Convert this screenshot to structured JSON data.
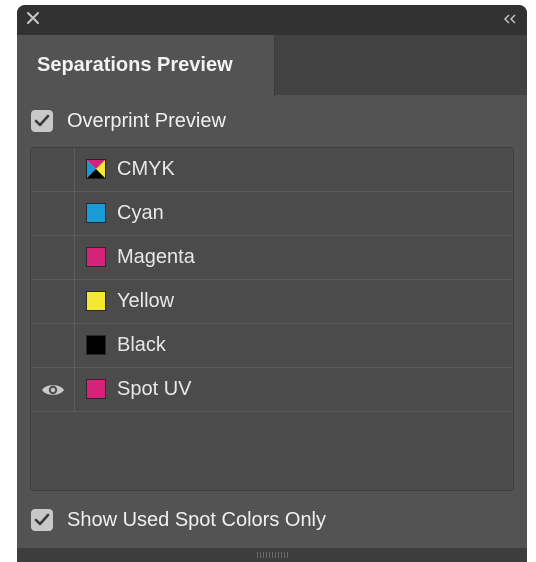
{
  "panel": {
    "tab_title": "Separations Preview"
  },
  "overprint": {
    "label": "Overprint Preview",
    "checked": true
  },
  "separations": [
    {
      "label": "CMYK",
      "swatch": "cmyk",
      "visible": false
    },
    {
      "label": "Cyan",
      "swatch": "#1a9ad6",
      "visible": false
    },
    {
      "label": "Magenta",
      "swatch": "#d6237a",
      "visible": false
    },
    {
      "label": "Yellow",
      "swatch": "#f5e834",
      "visible": false
    },
    {
      "label": "Black",
      "swatch": "#000000",
      "visible": false
    },
    {
      "label": "Spot UV",
      "swatch": "#d6237a",
      "visible": true
    }
  ],
  "spot_only": {
    "label": "Show Used Spot Colors Only",
    "checked": true
  },
  "icons": {
    "close": "close-icon",
    "collapse": "double-chevron-left-icon",
    "eye": "eye-icon",
    "check": "checkmark-icon"
  }
}
